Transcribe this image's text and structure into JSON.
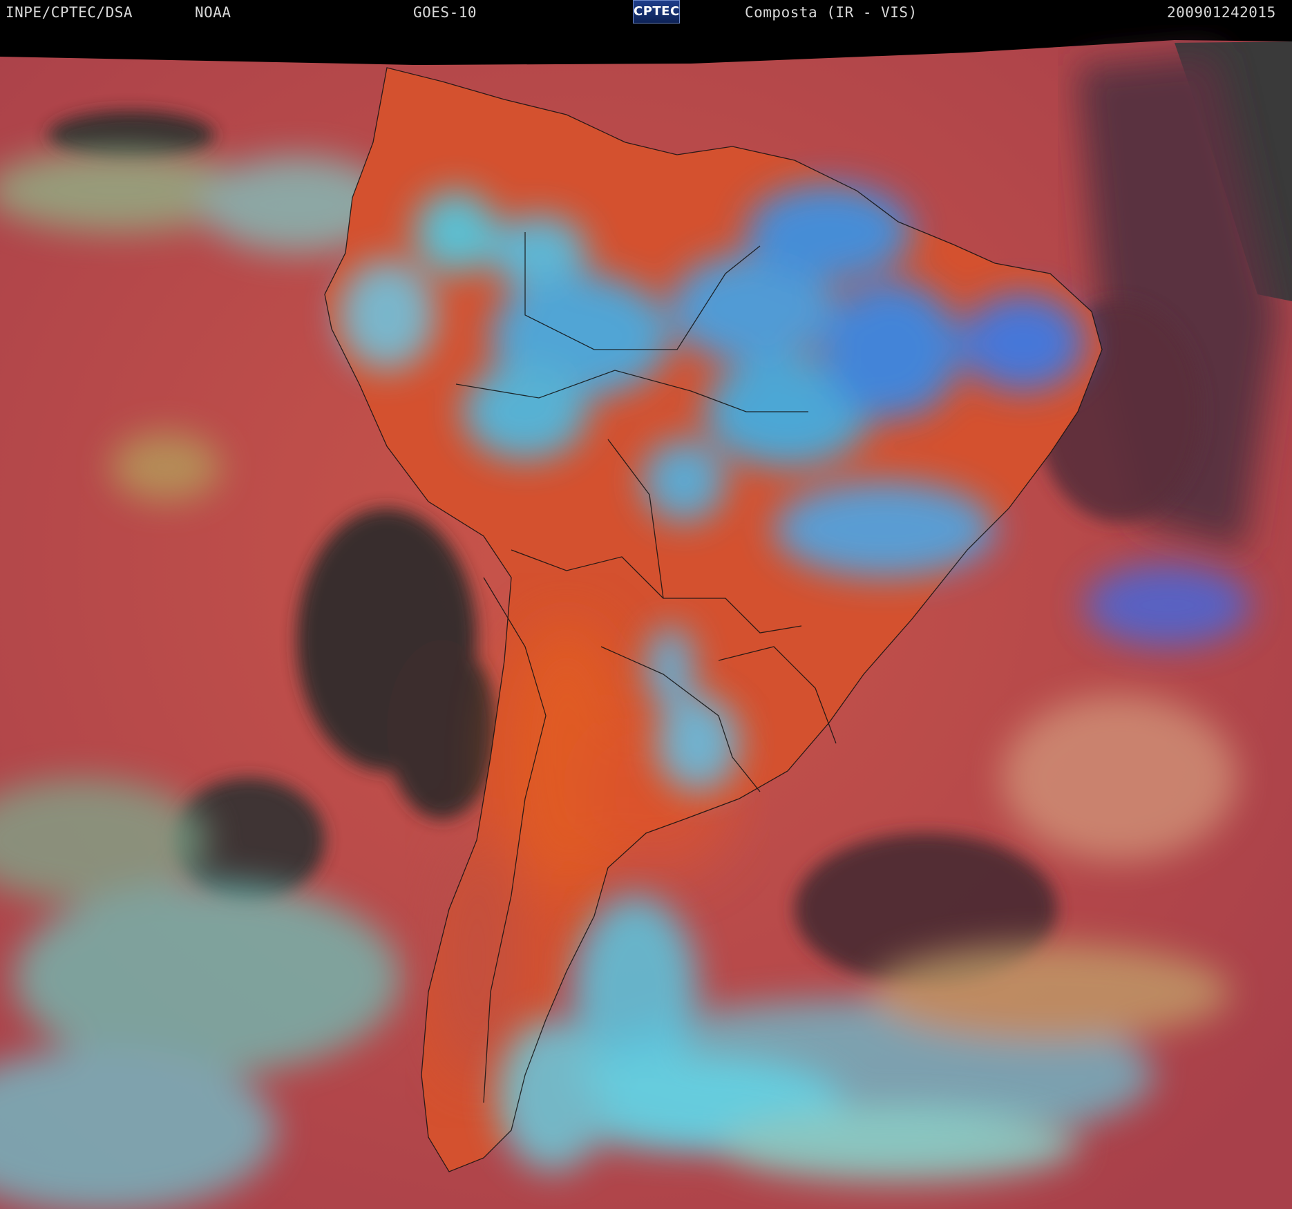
{
  "header": {
    "source": "INPE/CPTEC/DSA",
    "agency": "NOAA",
    "satellite": "GOES-10",
    "logo": "CPTEC",
    "product": "Composta (IR - VIS)",
    "timestamp": "200901242015"
  },
  "colors": {
    "ocean": "#c14a47",
    "land": "#d9542f",
    "clear_sky": "#2a2a2a",
    "low_cloud": "#a8d89a",
    "high_cloud": "#3bb0f0",
    "deep_convection": "#2a6cf0",
    "border": "#111111",
    "no_data": "#000000"
  }
}
